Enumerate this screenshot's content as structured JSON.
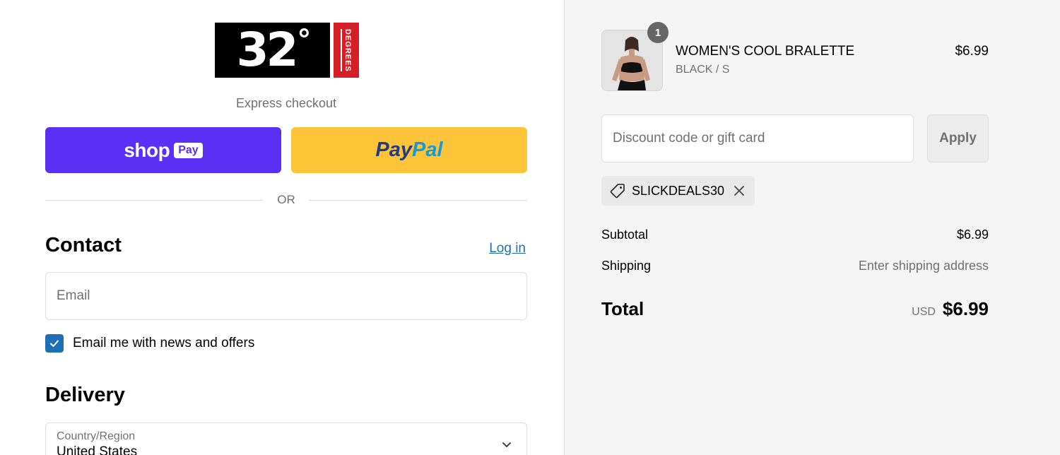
{
  "brand": {
    "logo_text": "32",
    "logo_degree": "°",
    "logo_side_text": "DEGREES",
    "red": "#d51f26"
  },
  "express": {
    "title": "Express checkout",
    "shop_pay": {
      "word": "shop",
      "box": "Pay",
      "color": "#5a31f4"
    },
    "paypal": {
      "part1": "Pay",
      "part2": "Pal",
      "color": "#ffc439"
    },
    "divider_text": "OR"
  },
  "contact": {
    "heading": "Contact",
    "login_link": "Log in",
    "email_placeholder": "Email",
    "email_value": "",
    "newsletter_label": "Email me with news and offers",
    "newsletter_checked": true
  },
  "delivery": {
    "heading": "Delivery",
    "country_label": "Country/Region",
    "country_value": "United States"
  },
  "summary": {
    "item": {
      "quantity": "1",
      "name": "WOMEN'S COOL BRALETTE",
      "variant": "BLACK / S",
      "price": "$6.99"
    },
    "discount_placeholder": "Discount code or gift card",
    "apply_label": "Apply",
    "applied_code": "SLICKDEALS30",
    "subtotal_label": "Subtotal",
    "subtotal_value": "$6.99",
    "shipping_label": "Shipping",
    "shipping_value": "Enter shipping address",
    "total_label": "Total",
    "currency": "USD",
    "total_value": "$6.99"
  },
  "colors": {
    "link": "#1f6fb6",
    "muted": "#707070"
  }
}
